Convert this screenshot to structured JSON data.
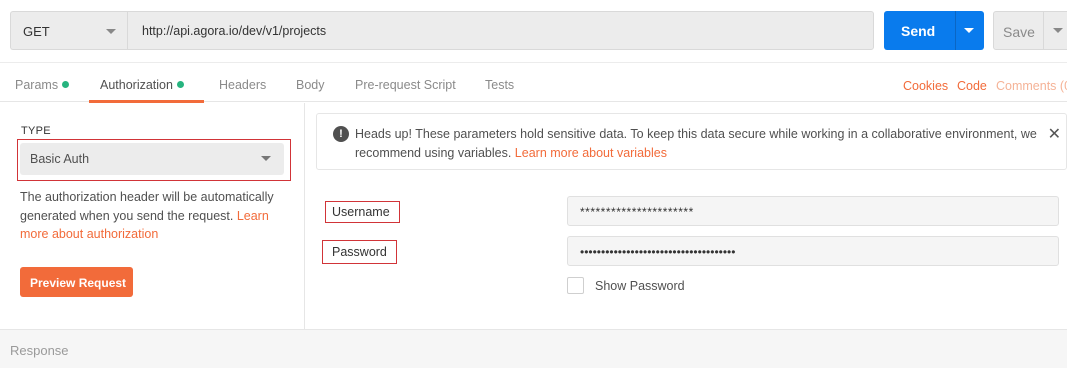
{
  "request": {
    "method": "GET",
    "url": "http://api.agora.io/dev/v1/projects",
    "send_label": "Send",
    "save_label": "Save"
  },
  "tabs": [
    {
      "label": "Params",
      "dot": true
    },
    {
      "label": "Authorization",
      "dot": true,
      "active": true
    },
    {
      "label": "Headers"
    },
    {
      "label": "Body"
    },
    {
      "label": "Pre-request Script"
    },
    {
      "label": "Tests"
    }
  ],
  "right_links": {
    "cookies": "Cookies",
    "code": "Code",
    "comments": "Comments (0"
  },
  "auth": {
    "type_label": "TYPE",
    "type_value": "Basic Auth",
    "description": "The authorization header will be automatically generated when you send the request. ",
    "description_link": "Learn more about authorization",
    "preview_button": "Preview Request"
  },
  "alert": {
    "text": "Heads up! These parameters hold sensitive data. To keep this data secure while working in a collaborative environment, we recommend using variables. ",
    "link": "Learn more about variables"
  },
  "fields": {
    "username_label": "Username",
    "username_value": "**********************",
    "password_label": "Password",
    "password_value": "•••••••••••••••••••••••••••••••••••••",
    "show_password_label": "Show Password"
  },
  "response": {
    "label": "Response"
  },
  "colors": {
    "accent": "#f26b3a",
    "send": "#097bed",
    "dot": "#26b47f",
    "highlight_box": "#d13438"
  }
}
